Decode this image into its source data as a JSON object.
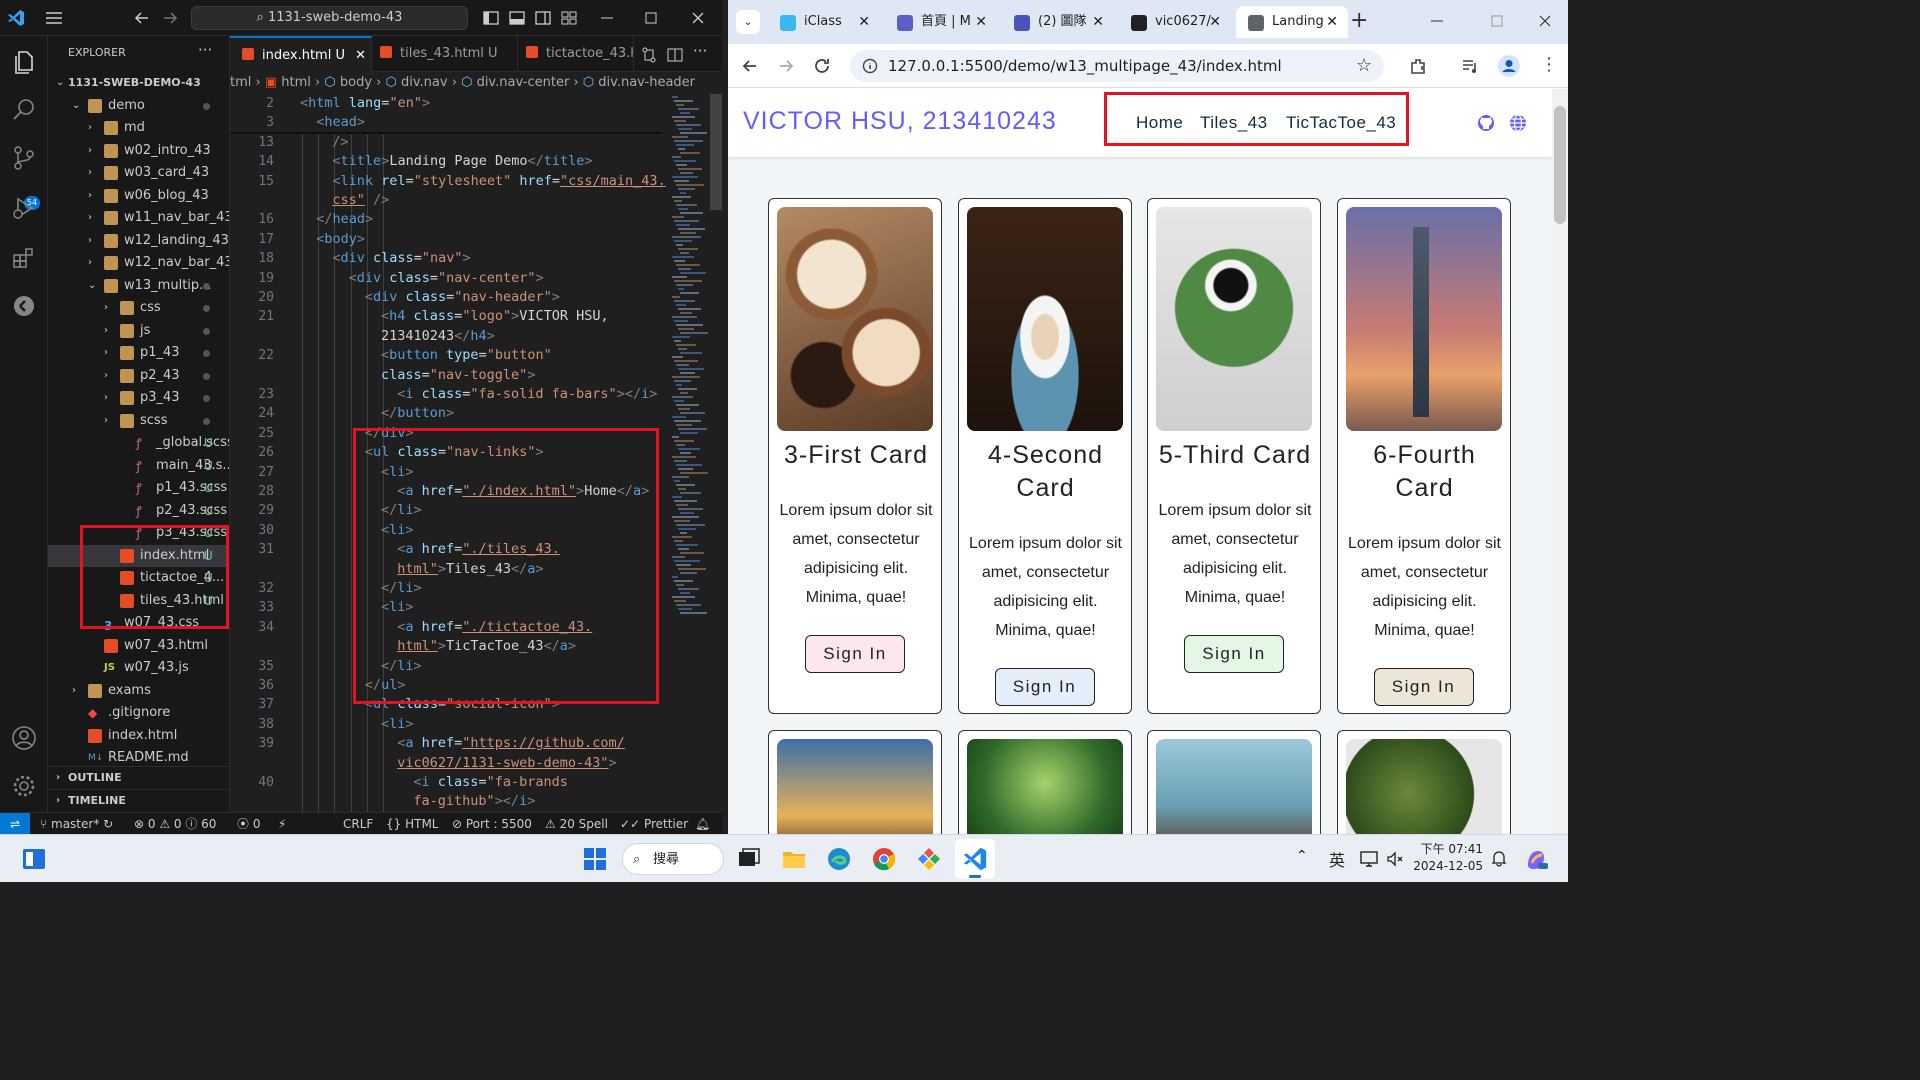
{
  "vscode": {
    "command_center": "1131-sweb-demo-43",
    "explorer_title": "EXPLORER",
    "git_badge": "54",
    "tree": [
      {
        "label": "1131-SWEB-DEMO-43",
        "kind": "root",
        "depth": 0
      },
      {
        "label": "demo",
        "kind": "folder-open",
        "depth": 1,
        "dot": true
      },
      {
        "label": "md",
        "kind": "folder",
        "depth": 2
      },
      {
        "label": "w02_intro_43",
        "kind": "folder",
        "depth": 2
      },
      {
        "label": "w03_card_43",
        "kind": "folder",
        "depth": 2
      },
      {
        "label": "w06_blog_43",
        "kind": "folder",
        "depth": 2
      },
      {
        "label": "w11_nav_bar_43",
        "kind": "folder",
        "depth": 2
      },
      {
        "label": "w12_landing_43",
        "kind": "folder",
        "depth": 2
      },
      {
        "label": "w12_nav_bar_43",
        "kind": "folder",
        "depth": 2
      },
      {
        "label": "w13_multip...",
        "kind": "folder-open",
        "depth": 2,
        "dot": true
      },
      {
        "label": "css",
        "kind": "folder",
        "depth": 3,
        "dot": true
      },
      {
        "label": "js",
        "kind": "folder",
        "depth": 3,
        "dot": true
      },
      {
        "label": "p1_43",
        "kind": "folder",
        "depth": 3,
        "dot": true
      },
      {
        "label": "p2_43",
        "kind": "folder",
        "depth": 3,
        "dot": true
      },
      {
        "label": "p3_43",
        "kind": "folder",
        "depth": 3,
        "dot": true
      },
      {
        "label": "scss",
        "kind": "sass-folder",
        "depth": 3,
        "dot": true
      },
      {
        "label": "_global.scss",
        "kind": "sass",
        "depth": 4,
        "status": "U"
      },
      {
        "label": "main_43.s...",
        "kind": "sass",
        "depth": 4,
        "status": "U"
      },
      {
        "label": "p1_43.scss",
        "kind": "sass",
        "depth": 4,
        "status": "U"
      },
      {
        "label": "p2_43.scss",
        "kind": "sass",
        "depth": 4,
        "status": "U"
      },
      {
        "label": "p3_43.scss",
        "kind": "sass",
        "depth": 4,
        "status": "U"
      },
      {
        "label": "index.html",
        "kind": "html",
        "depth": 3,
        "status": "U",
        "selected": true
      },
      {
        "label": "tictactoe_4...",
        "kind": "html",
        "depth": 3,
        "status": "U"
      },
      {
        "label": "tiles_43.html",
        "kind": "html",
        "depth": 3,
        "status": "U"
      },
      {
        "label": "w07_43.css",
        "kind": "css",
        "depth": 2
      },
      {
        "label": "w07_43.html",
        "kind": "html",
        "depth": 2
      },
      {
        "label": "w07_43.js",
        "kind": "js",
        "depth": 2
      },
      {
        "label": "exams",
        "kind": "folder",
        "depth": 1
      },
      {
        "label": ".gitignore",
        "kind": "git",
        "depth": 1
      },
      {
        "label": "index.html",
        "kind": "html",
        "depth": 1
      },
      {
        "label": "README.md",
        "kind": "md",
        "depth": 1
      }
    ],
    "outline_label": "OUTLINE",
    "timeline_label": "TIMELINE",
    "tabs": [
      {
        "label": "index.html",
        "status": "U",
        "active": true
      },
      {
        "label": "tiles_43.html",
        "status": "U",
        "active": false
      },
      {
        "label": "tictactoe_43.ht",
        "status": "",
        "active": false
      }
    ],
    "breadcrumbs": [
      "tml",
      "html",
      "body",
      "div.nav",
      "div.nav-center",
      "div.nav-header"
    ],
    "code_lines": [
      {
        "n": "2",
        "tokens": [
          [
            "br",
            "<"
          ],
          [
            "tg",
            "html "
          ],
          [
            "at",
            "lang"
          ],
          [
            "tx",
            "="
          ],
          [
            "sp",
            "\"en\""
          ],
          [
            "br",
            ">"
          ]
        ],
        "indent": 0
      },
      {
        "n": "3",
        "tokens": [
          [
            "br",
            "<"
          ],
          [
            "tg",
            "head"
          ],
          [
            "br",
            ">"
          ]
        ],
        "indent": 1
      },
      {
        "n": "13",
        "tokens": [
          [
            "br",
            "/>"
          ]
        ],
        "indent": 2
      },
      {
        "n": "14",
        "tokens": [
          [
            "br",
            "<"
          ],
          [
            "tg",
            "title"
          ],
          [
            "br",
            ">"
          ],
          [
            "tx",
            "Landing Page Demo"
          ],
          [
            "br",
            "</"
          ],
          [
            "tg",
            "title"
          ],
          [
            "br",
            ">"
          ]
        ],
        "indent": 2
      },
      {
        "n": "15",
        "tokens": [
          [
            "br",
            "<"
          ],
          [
            "tg",
            "link "
          ],
          [
            "at",
            "rel"
          ],
          [
            "tx",
            "="
          ],
          [
            "sp",
            "\"stylesheet\" "
          ],
          [
            "at",
            "href"
          ],
          [
            "tx",
            "="
          ],
          [
            "sv",
            "\"css/main_43."
          ]
        ],
        "indent": 2
      },
      {
        "n": "",
        "tokens": [
          [
            "sv",
            "css\""
          ],
          [
            "tx",
            " "
          ],
          [
            "br",
            "/>"
          ]
        ],
        "indent": 2
      },
      {
        "n": "16",
        "tokens": [
          [
            "br",
            "</"
          ],
          [
            "tg",
            "head"
          ],
          [
            "br",
            ">"
          ]
        ],
        "indent": 1
      },
      {
        "n": "17",
        "tokens": [
          [
            "br",
            "<"
          ],
          [
            "tg",
            "body"
          ],
          [
            "br",
            ">"
          ]
        ],
        "indent": 1
      },
      {
        "n": "18",
        "tokens": [
          [
            "br",
            "<"
          ],
          [
            "tg",
            "div "
          ],
          [
            "at",
            "class"
          ],
          [
            "tx",
            "="
          ],
          [
            "sp",
            "\"nav\""
          ],
          [
            "br",
            ">"
          ]
        ],
        "indent": 2
      },
      {
        "n": "19",
        "tokens": [
          [
            "br",
            "<"
          ],
          [
            "tg",
            "div "
          ],
          [
            "at",
            "class"
          ],
          [
            "tx",
            "="
          ],
          [
            "sp",
            "\"nav-center\""
          ],
          [
            "br",
            ">"
          ]
        ],
        "indent": 3
      },
      {
        "n": "20",
        "tokens": [
          [
            "br",
            "<"
          ],
          [
            "tg",
            "div "
          ],
          [
            "at",
            "class"
          ],
          [
            "tx",
            "="
          ],
          [
            "sp",
            "\"nav-header\""
          ],
          [
            "br",
            ">"
          ]
        ],
        "indent": 4
      },
      {
        "n": "21",
        "tokens": [
          [
            "br",
            "<"
          ],
          [
            "tg",
            "h4 "
          ],
          [
            "at",
            "class"
          ],
          [
            "tx",
            "="
          ],
          [
            "sp",
            "\"logo\""
          ],
          [
            "br",
            ">"
          ],
          [
            "tx",
            "VICTOR HSU,"
          ]
        ],
        "indent": 5
      },
      {
        "n": "",
        "tokens": [
          [
            "tx",
            "213410243"
          ],
          [
            "br",
            "</"
          ],
          [
            "tg",
            "h4"
          ],
          [
            "br",
            ">"
          ]
        ],
        "indent": 5
      },
      {
        "n": "22",
        "tokens": [
          [
            "br",
            "<"
          ],
          [
            "tg",
            "button "
          ],
          [
            "at",
            "type"
          ],
          [
            "tx",
            "="
          ],
          [
            "sp",
            "\"button\""
          ]
        ],
        "indent": 5
      },
      {
        "n": "",
        "tokens": [
          [
            "at",
            "class"
          ],
          [
            "tx",
            "="
          ],
          [
            "sp",
            "\"nav-toggle\""
          ],
          [
            "br",
            ">"
          ]
        ],
        "indent": 5
      },
      {
        "n": "23",
        "tokens": [
          [
            "br",
            "<"
          ],
          [
            "tg",
            "i "
          ],
          [
            "at",
            "class"
          ],
          [
            "tx",
            "="
          ],
          [
            "sp",
            "\"fa-solid fa-bars\""
          ],
          [
            "br",
            "></"
          ],
          [
            "tg",
            "i"
          ],
          [
            "br",
            ">"
          ]
        ],
        "indent": 6
      },
      {
        "n": "24",
        "tokens": [
          [
            "br",
            "</"
          ],
          [
            "tg",
            "button"
          ],
          [
            "br",
            ">"
          ]
        ],
        "indent": 5
      },
      {
        "n": "25",
        "tokens": [
          [
            "br",
            "</"
          ],
          [
            "tg",
            "div"
          ],
          [
            "br",
            ">"
          ]
        ],
        "indent": 4
      },
      {
        "n": "26",
        "tokens": [
          [
            "br",
            "<"
          ],
          [
            "tg",
            "ul "
          ],
          [
            "at",
            "class"
          ],
          [
            "tx",
            "="
          ],
          [
            "sp",
            "\"nav-links\""
          ],
          [
            "br",
            ">"
          ]
        ],
        "indent": 4
      },
      {
        "n": "27",
        "tokens": [
          [
            "br",
            "<"
          ],
          [
            "tg",
            "li"
          ],
          [
            "br",
            ">"
          ]
        ],
        "indent": 5
      },
      {
        "n": "28",
        "tokens": [
          [
            "br",
            "<"
          ],
          [
            "tg",
            "a "
          ],
          [
            "at",
            "href"
          ],
          [
            "tx",
            "="
          ],
          [
            "sv",
            "\"./index.html\""
          ],
          [
            "br",
            ">"
          ],
          [
            "tx",
            "Home"
          ],
          [
            "br",
            "</"
          ],
          [
            "tg",
            "a"
          ],
          [
            "br",
            ">"
          ]
        ],
        "indent": 6
      },
      {
        "n": "29",
        "tokens": [
          [
            "br",
            "</"
          ],
          [
            "tg",
            "li"
          ],
          [
            "br",
            ">"
          ]
        ],
        "indent": 5
      },
      {
        "n": "30",
        "tokens": [
          [
            "br",
            "<"
          ],
          [
            "tg",
            "li"
          ],
          [
            "br",
            ">"
          ]
        ],
        "indent": 5
      },
      {
        "n": "31",
        "tokens": [
          [
            "br",
            "<"
          ],
          [
            "tg",
            "a "
          ],
          [
            "at",
            "href"
          ],
          [
            "tx",
            "="
          ],
          [
            "sv",
            "\"./tiles_43."
          ]
        ],
        "indent": 6
      },
      {
        "n": "",
        "tokens": [
          [
            "sv",
            "html\""
          ],
          [
            "br",
            ">"
          ],
          [
            "tx",
            "Tiles_43"
          ],
          [
            "br",
            "</"
          ],
          [
            "tg",
            "a"
          ],
          [
            "br",
            ">"
          ]
        ],
        "indent": 6
      },
      {
        "n": "32",
        "tokens": [
          [
            "br",
            "</"
          ],
          [
            "tg",
            "li"
          ],
          [
            "br",
            ">"
          ]
        ],
        "indent": 5
      },
      {
        "n": "33",
        "tokens": [
          [
            "br",
            "<"
          ],
          [
            "tg",
            "li"
          ],
          [
            "br",
            ">"
          ]
        ],
        "indent": 5
      },
      {
        "n": "34",
        "tokens": [
          [
            "br",
            "<"
          ],
          [
            "tg",
            "a "
          ],
          [
            "at",
            "href"
          ],
          [
            "tx",
            "="
          ],
          [
            "sv",
            "\"./tictactoe_43."
          ]
        ],
        "indent": 6
      },
      {
        "n": "",
        "tokens": [
          [
            "sv",
            "html\""
          ],
          [
            "br",
            ">"
          ],
          [
            "tx",
            "TicTacToe_43"
          ],
          [
            "br",
            "</"
          ],
          [
            "tg",
            "a"
          ],
          [
            "br",
            ">"
          ]
        ],
        "indent": 6
      },
      {
        "n": "35",
        "tokens": [
          [
            "br",
            "</"
          ],
          [
            "tg",
            "li"
          ],
          [
            "br",
            ">"
          ]
        ],
        "indent": 5
      },
      {
        "n": "36",
        "tokens": [
          [
            "br",
            "</"
          ],
          [
            "tg",
            "ul"
          ],
          [
            "br",
            ">"
          ]
        ],
        "indent": 4
      },
      {
        "n": "37",
        "tokens": [
          [
            "br",
            "<"
          ],
          [
            "tg",
            "ul "
          ],
          [
            "at",
            "class"
          ],
          [
            "tx",
            "="
          ],
          [
            "sp",
            "\"social-icon\""
          ],
          [
            "br",
            ">"
          ]
        ],
        "indent": 4
      },
      {
        "n": "38",
        "tokens": [
          [
            "br",
            "<"
          ],
          [
            "tg",
            "li"
          ],
          [
            "br",
            ">"
          ]
        ],
        "indent": 5
      },
      {
        "n": "39",
        "tokens": [
          [
            "br",
            "<"
          ],
          [
            "tg",
            "a "
          ],
          [
            "at",
            "href"
          ],
          [
            "tx",
            "="
          ],
          [
            "sv",
            "\"https://github.com/"
          ]
        ],
        "indent": 6
      },
      {
        "n": "",
        "tokens": [
          [
            "sv",
            "vic0627/1131-sweb-demo-43\""
          ],
          [
            "br",
            ">"
          ]
        ],
        "indent": 6
      },
      {
        "n": "40",
        "tokens": [
          [
            "br",
            "<"
          ],
          [
            "tg",
            "i "
          ],
          [
            "at",
            "class"
          ],
          [
            "tx",
            "="
          ],
          [
            "sp",
            "\"fa-brands"
          ]
        ],
        "indent": 7
      },
      {
        "n": "",
        "tokens": [
          [
            "sp",
            "fa-github\""
          ],
          [
            "br",
            "></"
          ],
          [
            "tg",
            "i"
          ],
          [
            "br",
            ">"
          ]
        ],
        "indent": 7
      }
    ],
    "status": {
      "branch": "master*",
      "problems": "⊗ 0 ⚠ 0 ⓘ 60",
      "ports_count": "0",
      "eol": "CRLF",
      "language": "HTML",
      "port": "Port : 5500",
      "spell": "20 Spell",
      "formatter": "Prettier"
    }
  },
  "chrome": {
    "tabs": [
      {
        "label": "iClass",
        "active": false,
        "color": "#3bb7f0"
      },
      {
        "label": "首頁 | M",
        "active": false,
        "color": "#5b5fc7"
      },
      {
        "label": "(2) 圖隊",
        "active": false,
        "color": "#4b53bc"
      },
      {
        "label": "vic0627/",
        "active": false,
        "color": "#222222"
      },
      {
        "label": "Landing",
        "active": true,
        "color": "#5f6368"
      }
    ],
    "url": "127.0.0.1:5500/demo/w13_multipage_43/index.html",
    "site": {
      "logo": "VICTOR HSU, 213410243",
      "nav_links": [
        "Home",
        "Tiles_43",
        "TicTacToe_43"
      ],
      "cards": [
        {
          "title": "3-First Card",
          "text": "Lorem ipsum dolor sit amet, consectetur adipisicing elit. Minima, quae!",
          "button": "Sign In",
          "button_color": "#fde7ef"
        },
        {
          "title": "4-Second Card",
          "text": "Lorem ipsum dolor sit amet, consectetur adipisicing elit. Minima, quae!",
          "button": "Sign In",
          "button_color": "#e3eefa"
        },
        {
          "title": "5-Third Card",
          "text": "Lorem ipsum dolor sit amet, consectetur adipisicing elit. Minima, quae!",
          "button": "Sign In",
          "button_color": "#e4f6e4"
        },
        {
          "title": "6-Fourth Card",
          "text": "Lorem ipsum dolor sit amet, consectetur adipisicing elit. Minima, quae!",
          "button": "Sign In",
          "button_color": "#ece6d8"
        }
      ]
    }
  },
  "taskbar": {
    "search_label": "搜尋",
    "ime": "英",
    "time": "下午 07:41",
    "date": "2024-12-05"
  },
  "colors": {
    "accent": "#0078d4",
    "logo": "#645cff",
    "highlight_box": "#e81123"
  }
}
